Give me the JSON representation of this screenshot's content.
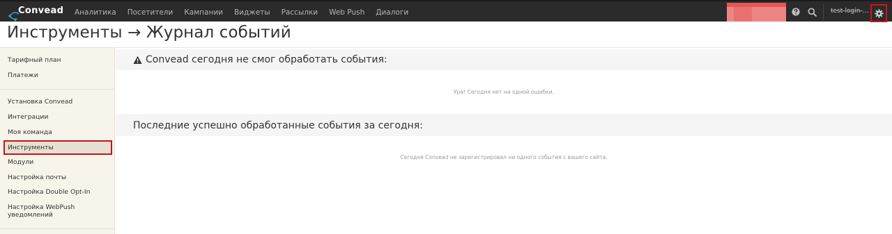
{
  "brand": {
    "name": "Convead"
  },
  "nav": {
    "items": [
      "Аналитика",
      "Посетители",
      "Кампании",
      "Виджеты",
      "Рассылки",
      "Web Push",
      "Диалоги"
    ]
  },
  "header": {
    "user_name": "test-login-convead",
    "icons": [
      "question-circle-icon",
      "search-icon",
      "gear-icon"
    ]
  },
  "page": {
    "title": "Инструменты → Журнал событий"
  },
  "sidebar": {
    "group1": [
      "Тарифный план",
      "Платежи"
    ],
    "group2": [
      "Установка Convead",
      "Интеграции",
      "Моя команда",
      "Инструменты",
      "Модули",
      "Настройка почты",
      "Настройка Double Opt-In",
      "Настройка WebPush уведомлений"
    ],
    "active": "Инструменты"
  },
  "errors": {
    "title": "Convead сегодня не смог обработать события:",
    "empty": "Ура! Сегодня нет ни одной ошибки."
  },
  "events": {
    "title": "Последние успешно обработанные события за сегодня:",
    "empty": "Сегодня Convead не зарегистрировал ни одного события с вашего сайта."
  },
  "colors": {
    "topbar": "#2b2b2b",
    "sidebar": "#f7f4ea",
    "highlight": "#c8121b"
  }
}
